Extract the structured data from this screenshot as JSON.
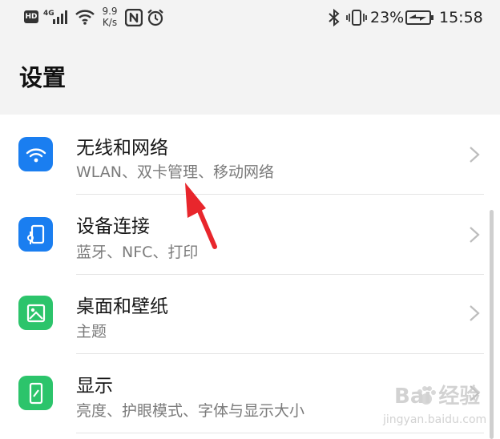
{
  "status_bar": {
    "hd": "HD",
    "signal": "4G",
    "speed_value": "9.9",
    "speed_unit": "K/s",
    "battery": "23%",
    "time": "15:58"
  },
  "page": {
    "title": "设置"
  },
  "items": [
    {
      "title": "无线和网络",
      "subtitle": "WLAN、双卡管理、移动网络",
      "icon": "wifi-icon",
      "color": "#1a7ef0"
    },
    {
      "title": "设备连接",
      "subtitle": "蓝牙、NFC、打印",
      "icon": "device-connection-icon",
      "color": "#1a7ef0"
    },
    {
      "title": "桌面和壁纸",
      "subtitle": "主题",
      "icon": "wallpaper-icon",
      "color": "#2cc46b"
    },
    {
      "title": "显示",
      "subtitle": "亮度、护眼模式、字体与显示大小",
      "icon": "display-icon",
      "color": "#2cc46b"
    }
  ],
  "annotation": {
    "arrow_color": "#e8262c"
  },
  "watermark": {
    "main": "Bai 经验",
    "sub": "jingyan.baidu.com"
  }
}
